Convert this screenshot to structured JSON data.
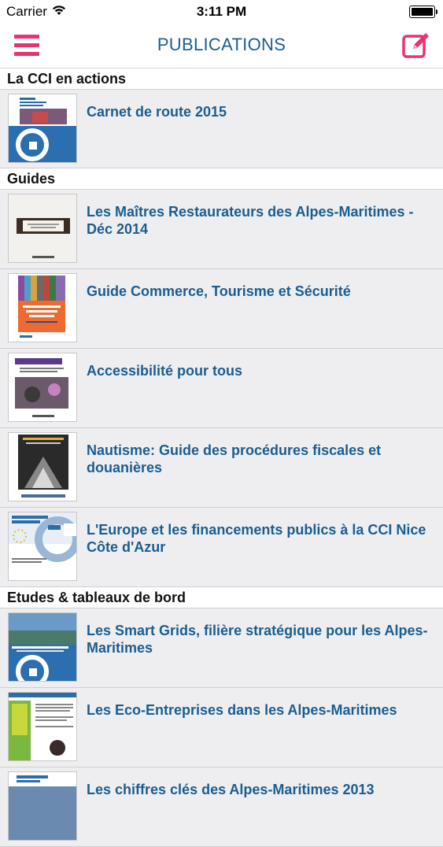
{
  "status_bar": {
    "carrier": "Carrier",
    "time": "3:11 PM"
  },
  "nav": {
    "title": "PUBLICATIONS",
    "menu_icon": "hamburger-menu-icon",
    "compose_icon": "compose-icon",
    "accent": "#e8336e",
    "title_color": "#1b5d8f"
  },
  "sections": [
    {
      "header": "La CCI en actions",
      "items": [
        {
          "title": "Carnet de route 2015"
        }
      ]
    },
    {
      "header": "Guides",
      "items": [
        {
          "title": "Les Maîtres Restaurateurs des Alpes-Maritimes - Déc 2014"
        },
        {
          "title": "Guide Commerce, Tourisme et Sécurité"
        },
        {
          "title": "Accessibilité pour tous"
        },
        {
          "title": "Nautisme: Guide des procédures fiscales et douanières"
        },
        {
          "title": "L'Europe et les financements publics à la CCI Nice Côte d'Azur"
        }
      ]
    },
    {
      "header": "Etudes & tableaux de bord",
      "items": [
        {
          "title": "Les Smart Grids, filière stratégique pour les Alpes-Maritimes"
        },
        {
          "title": "Les Eco-Entreprises dans les Alpes-Maritimes"
        },
        {
          "title": "Les chiffres clés des Alpes-Maritimes 2013"
        }
      ]
    }
  ]
}
